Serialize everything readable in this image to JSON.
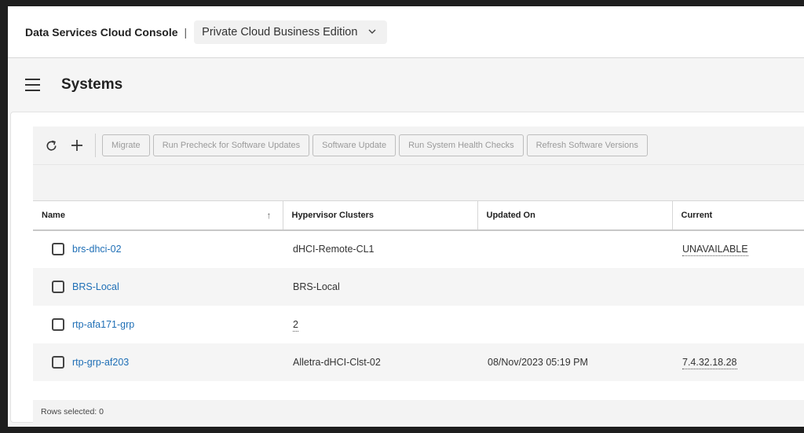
{
  "header": {
    "brand": "Data Services Cloud Console",
    "separator": "|",
    "edition": "Private Cloud Business Edition"
  },
  "page": {
    "title": "Systems"
  },
  "toolbar": {
    "buttons": [
      "Migrate",
      "Run Precheck for Software Updates",
      "Software Update",
      "Run System Health Checks",
      "Refresh Software Versions"
    ]
  },
  "table": {
    "columns": [
      "Name",
      "Hypervisor Clusters",
      "Updated On",
      "Current"
    ],
    "rows": [
      {
        "name": "brs-dhci-02",
        "clusters": "dHCI-Remote-CL1",
        "updated": "",
        "current": "UNAVAILABLE"
      },
      {
        "name": "BRS-Local",
        "clusters": "BRS-Local",
        "updated": "",
        "current": ""
      },
      {
        "name": "rtp-afa171-grp",
        "clusters": "2",
        "updated": "",
        "current": ""
      },
      {
        "name": "rtp-grp-af203",
        "clusters": "Alletra-dHCI-Clst-02",
        "updated": "08/Nov/2023 05:19 PM",
        "current": "7.4.32.18.28"
      }
    ]
  },
  "footer": {
    "rows_selected": "Rows selected: 0"
  },
  "colors": {
    "link": "#1f6fb6",
    "background": "#1e1e1e"
  }
}
